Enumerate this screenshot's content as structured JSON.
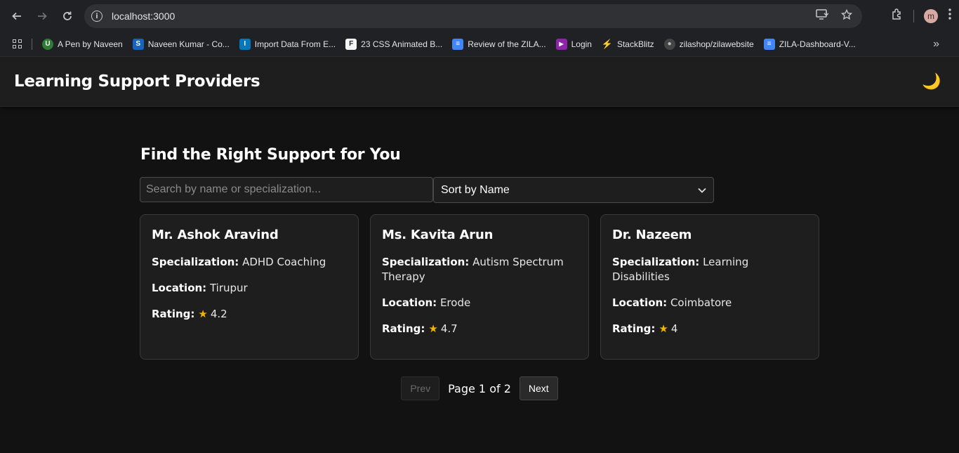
{
  "browser": {
    "url": "localhost:3000",
    "bookmarks": [
      {
        "label": "A Pen by Naveen",
        "color": "#2e7d32",
        "glyph": "U"
      },
      {
        "label": "Naveen Kumar - Co...",
        "color": "#1565c0",
        "glyph": "S"
      },
      {
        "label": "Import Data From E...",
        "color": "#0277bd",
        "glyph": "I"
      },
      {
        "label": "23 CSS Animated B...",
        "color": "#333333",
        "glyph": "F"
      },
      {
        "label": "Review of the ZILA...",
        "color": "#4285f4",
        "glyph": "≡"
      },
      {
        "label": "Login",
        "color": "#8e24aa",
        "glyph": "▶"
      },
      {
        "label": "StackBlitz",
        "color": "#1389fd",
        "glyph": "⚡"
      },
      {
        "label": "zilashop/zilawebsite",
        "color": "#444444",
        "glyph": "●"
      },
      {
        "label": "ZILA-Dashboard-V...",
        "color": "#4285f4",
        "glyph": "≡"
      }
    ],
    "avatar_letter": "m"
  },
  "app": {
    "title": "Learning Support Providers",
    "theme_icon": "🌙"
  },
  "main": {
    "heading": "Find the Right Support for You",
    "search_placeholder": "Search by name or specialization...",
    "sort_selected": "Sort by Name"
  },
  "labels": {
    "specialization": "Specialization:",
    "location": "Location:",
    "rating": "Rating:"
  },
  "providers": [
    {
      "name": "Mr. Ashok Aravind",
      "specialization": "ADHD Coaching",
      "location": "Tirupur",
      "rating": "4.2"
    },
    {
      "name": "Ms. Kavita Arun",
      "specialization": "Autism Spectrum Therapy",
      "location": "Erode",
      "rating": "4.7"
    },
    {
      "name": "Dr. Nazeem",
      "specialization": "Learning Disabilities",
      "location": "Coimbatore",
      "rating": "4"
    }
  ],
  "pagination": {
    "prev_label": "Prev",
    "next_label": "Next",
    "page_info": "Page 1 of 2"
  }
}
